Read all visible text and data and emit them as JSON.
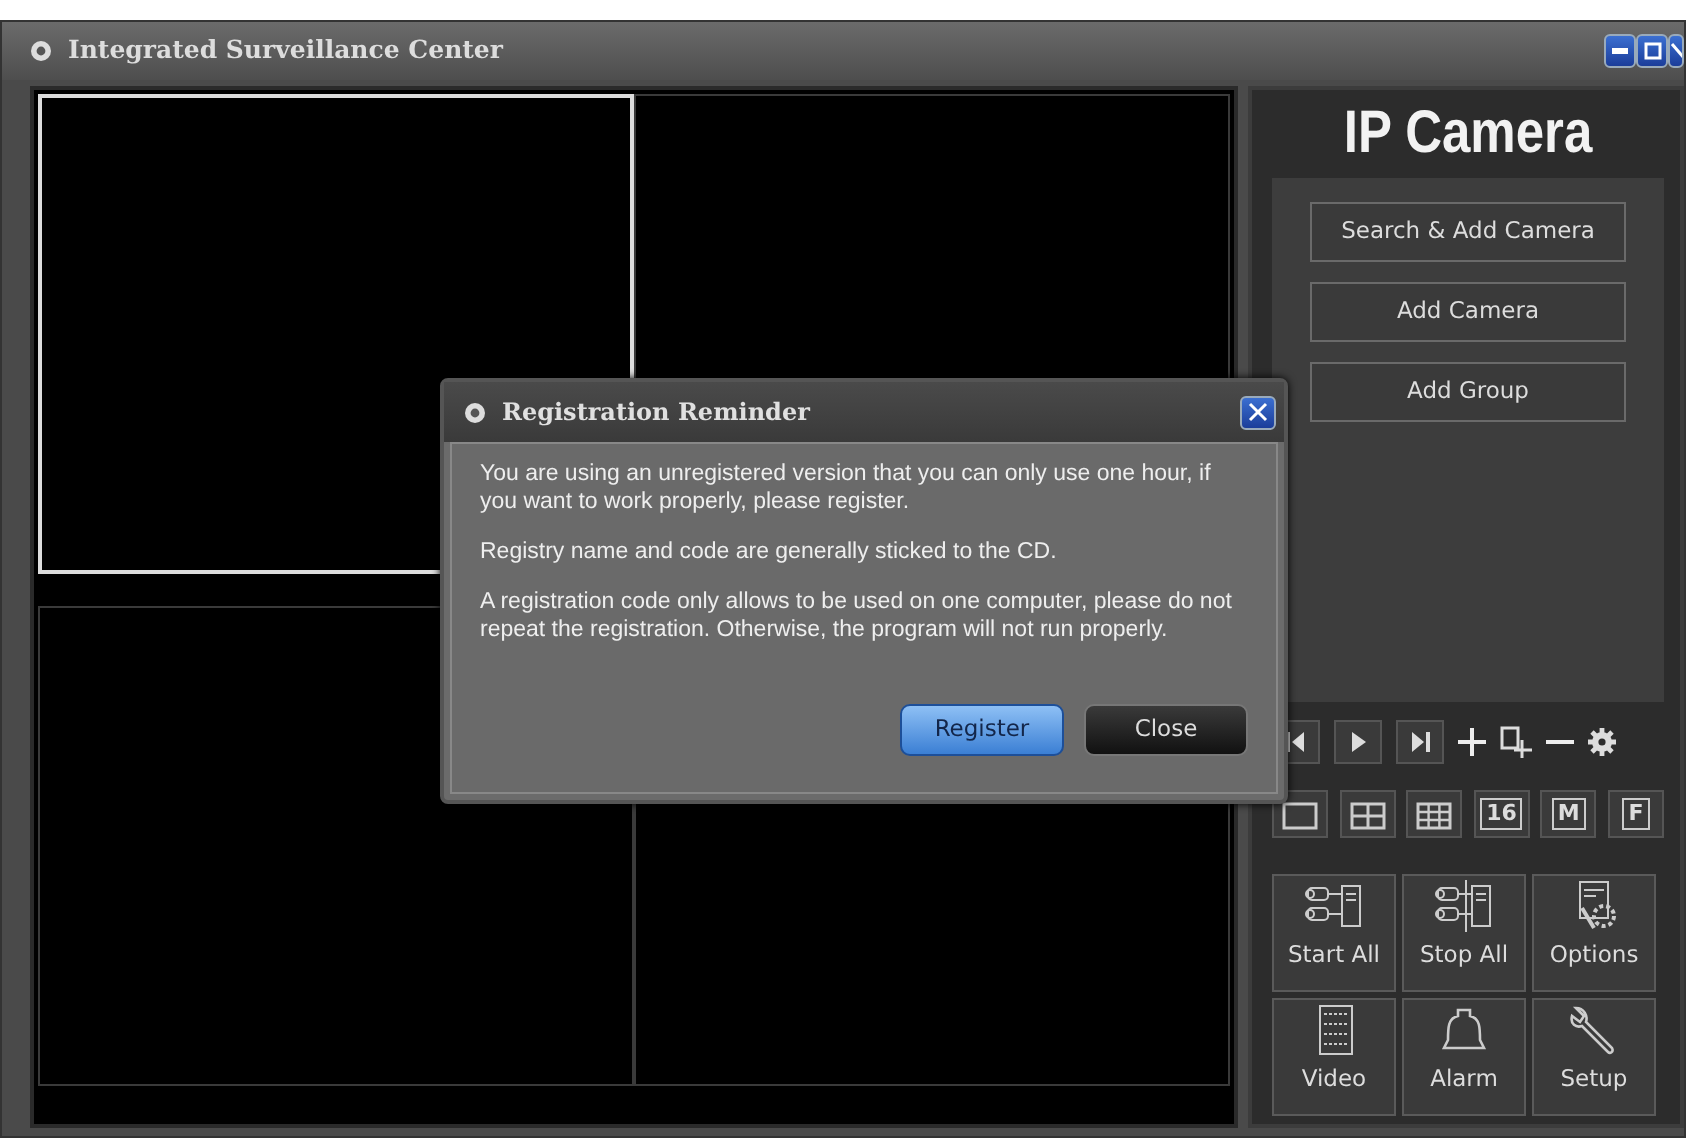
{
  "window": {
    "title": "Integrated Surveillance Center"
  },
  "video_cells": [
    {
      "selected": true
    },
    {
      "selected": false
    },
    {
      "selected": false
    },
    {
      "selected": false
    }
  ],
  "sidebar": {
    "header": "IP Camera",
    "camera_buttons": [
      "Search & Add Camera",
      "Add Camera",
      "Add Group"
    ],
    "layout_buttons": [
      {
        "kind": "single"
      },
      {
        "kind": "quad"
      },
      {
        "kind": "nine"
      },
      {
        "kind": "text",
        "label": "16"
      },
      {
        "kind": "text",
        "label": "M"
      },
      {
        "kind": "text",
        "label": "F"
      }
    ],
    "actions": [
      {
        "kind": "start",
        "label": "Start All"
      },
      {
        "kind": "stop",
        "label": "Stop All"
      },
      {
        "kind": "options",
        "label": "Options"
      },
      {
        "kind": "video",
        "label": "Video"
      },
      {
        "kind": "alarm",
        "label": "Alarm"
      },
      {
        "kind": "setup",
        "label": "Setup"
      }
    ]
  },
  "dialog": {
    "title": "Registration Reminder",
    "paragraphs": [
      "You are using an unregistered version that you can only use one hour, if you want to work properly, please register.",
      "Registry name and code are generally sticked to the CD.",
      "A registration code only allows to be used on one computer, please do not repeat the registration. Otherwise, the program will not run properly."
    ],
    "buttons": [
      {
        "label": "Register",
        "default": true
      },
      {
        "label": "Close",
        "default": false
      }
    ]
  }
}
